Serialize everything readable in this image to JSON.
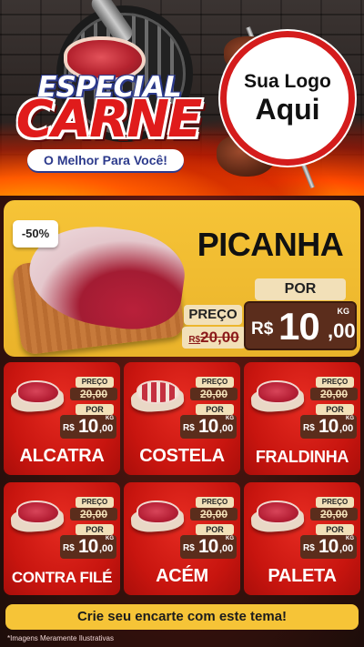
{
  "header": {
    "title_top": "ESPECIAL",
    "title_main": "CARNE",
    "tagline": "O Melhor Para Você!",
    "logo_line1": "Sua Logo",
    "logo_line2": "Aqui"
  },
  "feature": {
    "discount": "-50%",
    "name": "PICANHA",
    "price_label": "PREÇO",
    "old_price": "20,00",
    "old_currency": "R$",
    "por_label": "POR",
    "currency": "R$",
    "price_int": "10",
    "price_cents": ",00",
    "unit": "KG"
  },
  "cards": [
    {
      "name": "ALCATRA",
      "preco": "PREÇO",
      "old": "20,00",
      "por": "POR",
      "cur": "R$",
      "int": "10",
      "cents": ",00",
      "unit": "KG"
    },
    {
      "name": "COSTELA",
      "preco": "PREÇO",
      "old": "20,00",
      "por": "POR",
      "cur": "R$",
      "int": "10",
      "cents": ",00",
      "unit": "KG"
    },
    {
      "name": "FRALDINHA",
      "preco": "PREÇO",
      "old": "20,00",
      "por": "POR",
      "cur": "R$",
      "int": "10",
      "cents": ",00",
      "unit": "KG"
    },
    {
      "name": "CONTRA FILÉ",
      "preco": "PREÇO",
      "old": "20,00",
      "por": "POR",
      "cur": "R$",
      "int": "10",
      "cents": ",00",
      "unit": "KG"
    },
    {
      "name": "ACÉM",
      "preco": "PREÇO",
      "old": "20,00",
      "por": "POR",
      "cur": "R$",
      "int": "10",
      "cents": ",00",
      "unit": "KG"
    },
    {
      "name": "PALETA",
      "preco": "PREÇO",
      "old": "20,00",
      "por": "POR",
      "cur": "R$",
      "int": "10",
      "cents": ",00",
      "unit": "KG"
    }
  ],
  "footer": {
    "cta": "Crie seu encarte com este tema!",
    "disclaimer": "*Imagens Meramente Ilustrativas"
  },
  "colors": {
    "accent_yellow": "#f6c437",
    "card_red": "#c8150f",
    "price_brown": "#5b2d1c",
    "logo_red": "#d41c1c"
  },
  "icons": [
    "grill-icon",
    "steak-icon",
    "skewer-icon",
    "meat-icon"
  ]
}
